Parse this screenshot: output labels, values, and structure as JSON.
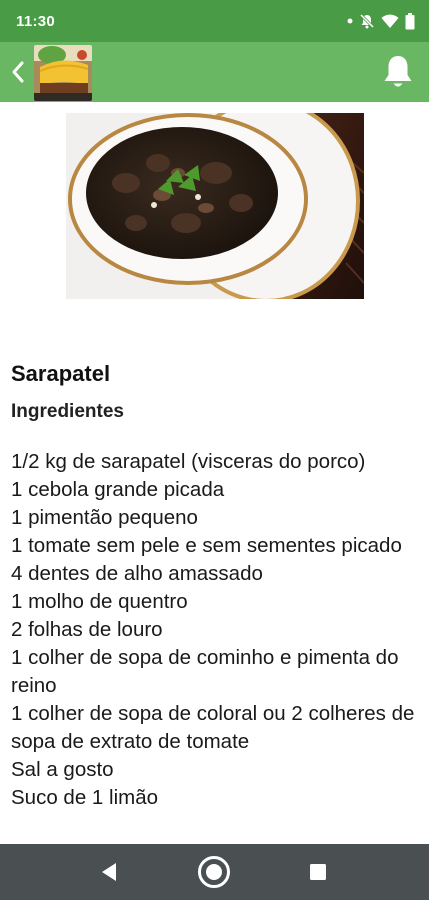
{
  "status_bar": {
    "time": "11:30",
    "icons": [
      "dot-icon",
      "mute-icon",
      "wifi-icon",
      "battery-icon"
    ]
  },
  "app_bar": {
    "back_icon": "chevron-left-icon",
    "thumbnail": "recipe-thumbnail",
    "notification_icon": "bell-icon"
  },
  "recipe": {
    "image": "sarapatel-dish-photo",
    "title": "Sarapatel",
    "ingredients_heading": "Ingredientes",
    "ingredients": [
      "1/2 kg de sarapatel (visceras do porco)",
      "1 cebola grande picada",
      "1 pimentão pequeno",
      "1 tomate sem pele e sem sementes picado",
      "4 dentes de alho amassado",
      "1 molho de quentro",
      "2 folhas de louro",
      "1 colher de sopa de cominho e pimenta do reino",
      "1 colher de sopa de coloral ou 2 colheres de sopa de extrato de tomate",
      "Sal a gosto",
      "Suco de 1 limão"
    ]
  },
  "nav_bar": {
    "icons": [
      "back-triangle-icon",
      "home-circle-icon",
      "recents-square-icon"
    ]
  },
  "colors": {
    "status_bar": "#4a9b45",
    "app_bar": "#6ab763",
    "nav_bar": "#4a4f52"
  }
}
